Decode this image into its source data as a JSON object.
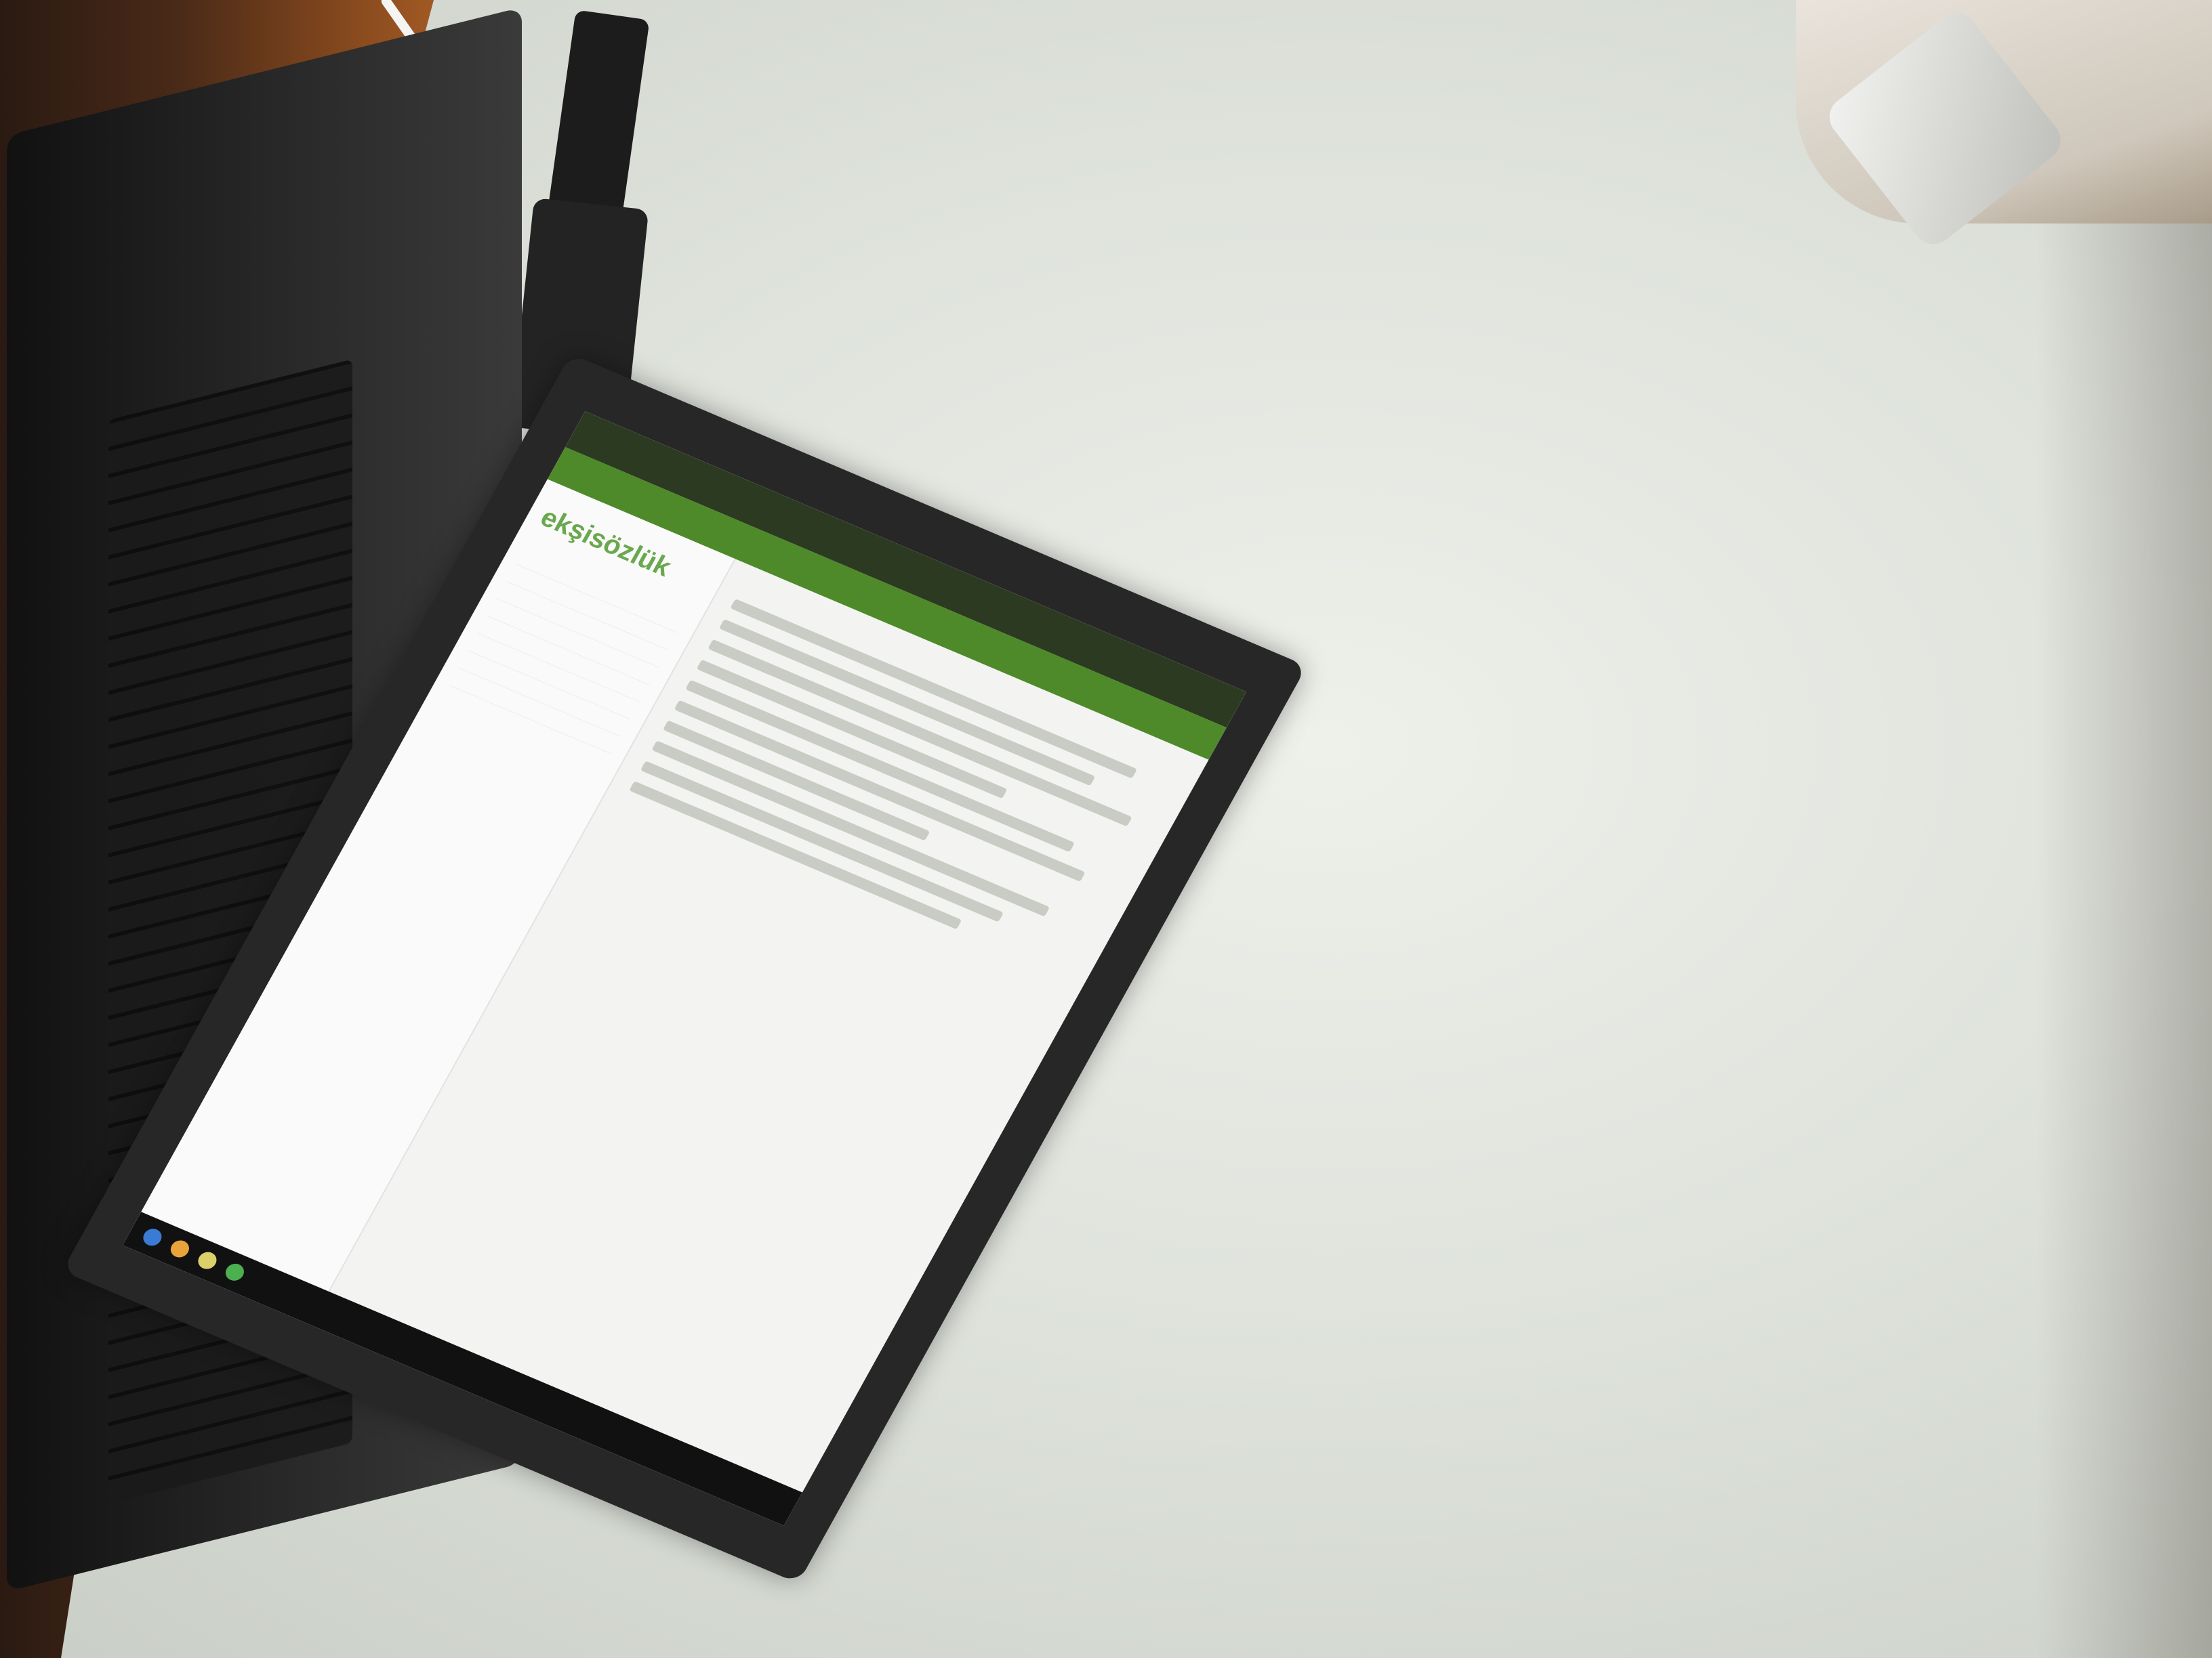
{
  "scene": {
    "description_free": true,
    "colors": {
      "wall": "#e3e6df",
      "desk": "#8a4b1e",
      "browser_accent": "#4e8a2a",
      "screen_bg": "#f3f4f2"
    }
  },
  "screen": {
    "tab_label": "",
    "bookmarks": [
      "",
      "",
      "",
      "",
      "",
      ""
    ],
    "logo": "ekşisözlük",
    "sidebar_items": [
      "",
      "",
      "",
      "",
      "",
      "",
      "",
      ""
    ]
  }
}
